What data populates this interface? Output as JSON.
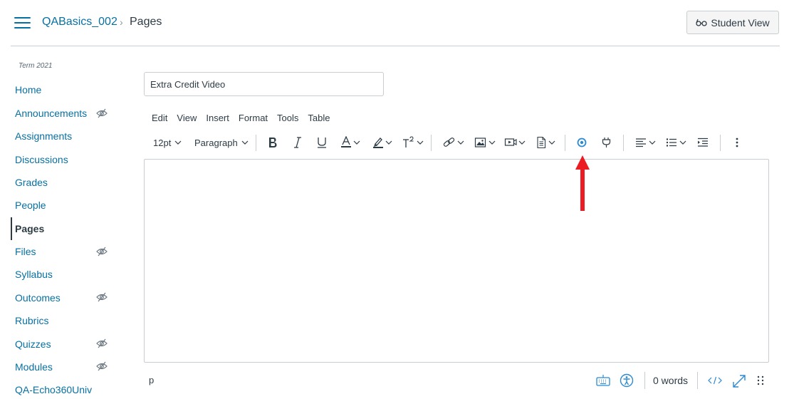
{
  "header": {
    "course": "QABasics_002",
    "separator": "›",
    "page": "Pages",
    "student_view": "Student View"
  },
  "sidebar": {
    "term": "Term 2021",
    "items": [
      {
        "label": "Home"
      },
      {
        "label": "Announcements",
        "hidden": true
      },
      {
        "label": "Assignments"
      },
      {
        "label": "Discussions"
      },
      {
        "label": "Grades"
      },
      {
        "label": "People"
      },
      {
        "label": "Pages",
        "active": true
      },
      {
        "label": "Files",
        "hidden": true
      },
      {
        "label": "Syllabus"
      },
      {
        "label": "Outcomes",
        "hidden": true
      },
      {
        "label": "Rubrics"
      },
      {
        "label": "Quizzes",
        "hidden": true
      },
      {
        "label": "Modules",
        "hidden": true
      },
      {
        "label": "QA-Echo360Univ"
      }
    ]
  },
  "editor": {
    "title_value": "Extra Credit Video",
    "menu": [
      "Edit",
      "View",
      "Insert",
      "Format",
      "Tools",
      "Table"
    ],
    "font_size": "12pt",
    "block_format": "Paragraph",
    "status_path": "p",
    "word_count": "0 words"
  },
  "colors": {
    "link": "#0770a3",
    "text": "#2d3b45",
    "border": "#c7cdd1",
    "plugin_accent": "#2b8ad1",
    "arrow": "#ec1c24"
  }
}
